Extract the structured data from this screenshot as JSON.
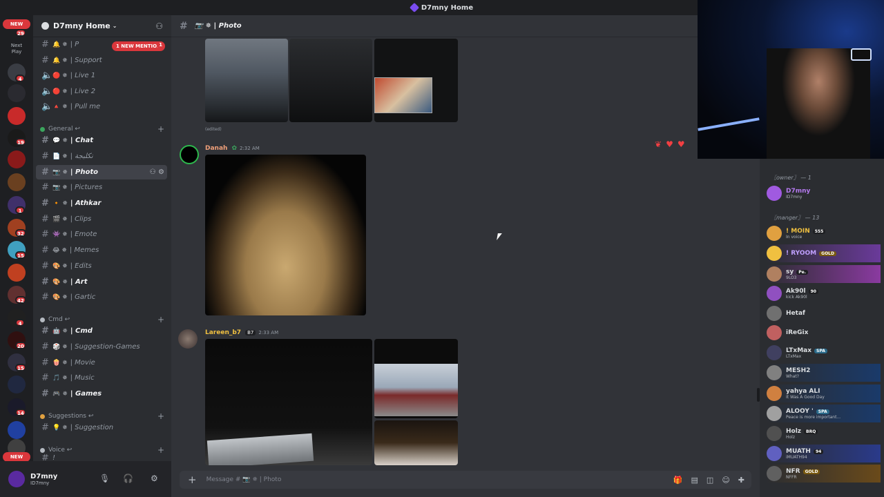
{
  "window": {
    "title": "D7mny Home"
  },
  "rail": {
    "new_top": "NEW",
    "badge_top": "29",
    "next_play": "Next Play",
    "badges": [
      "4",
      "19",
      "1",
      "32",
      "15",
      "42",
      "4",
      "20",
      "15",
      "14"
    ],
    "new_bottom": "NEW"
  },
  "server": {
    "name": "D7mny Home"
  },
  "mention": {
    "pill": "1 NEW MENTION",
    "count": "1"
  },
  "channels": {
    "top": [
      {
        "emoji": "🔔 ✵",
        "label": "| P"
      },
      {
        "emoji": "🔔 ✵",
        "label": "| Support"
      },
      {
        "emoji": "🔴 ✵",
        "label": "| Live 1"
      },
      {
        "emoji": "🔴 ✵",
        "label": "| Live 2"
      },
      {
        "emoji": "🔺 ✵",
        "label": "| Pull me"
      }
    ],
    "general_cat": "General ↩",
    "general": [
      {
        "emoji": "💬 ✵",
        "label": "| Chat"
      },
      {
        "emoji": "📄 ✵",
        "label": "| نكلبجة"
      },
      {
        "emoji": "📷 ✵",
        "label": "| Photo"
      },
      {
        "emoji": "📷 ✵",
        "label": "| Pictures"
      },
      {
        "emoji": "🔸 ✵",
        "label": "| Athkar"
      },
      {
        "emoji": "🎬 ✵",
        "label": "| Clips"
      },
      {
        "emoji": "👾 ✵",
        "label": "| Emote"
      },
      {
        "emoji": "😂 ✵",
        "label": "| Memes"
      },
      {
        "emoji": "🎨 ✵",
        "label": "| Edits"
      },
      {
        "emoji": "🎨 ✵",
        "label": "| Art"
      },
      {
        "emoji": "🎨 ✵",
        "label": "| Gartic"
      }
    ],
    "cmd_cat": "Cmd ↩",
    "cmd": [
      {
        "emoji": "🤖 ✵",
        "label": "| Cmd"
      },
      {
        "emoji": "🎲 ✵",
        "label": "| Suggestion-Games"
      },
      {
        "emoji": "🍿 ✵",
        "label": "| Movie"
      },
      {
        "emoji": "🎵 ✵",
        "label": "| Music"
      },
      {
        "emoji": "🎮 ✵",
        "label": "| Games"
      }
    ],
    "sugg_cat": "Suggestions ↩",
    "sugg": [
      {
        "emoji": "💡 ✵",
        "label": "| Suggestion"
      }
    ],
    "voice_cat": "Voice ↩",
    "voice_partial": "!"
  },
  "user": {
    "name": "D7mny",
    "tag": "ID7mny"
  },
  "chat": {
    "channel": "📷 ✵ | Photo",
    "edited": "(edited)",
    "msg1": {
      "author": "Danah",
      "time": "2:32 AM"
    },
    "msg2": {
      "author": "Lareen_b7",
      "badge": "B7",
      "time": "2:33 AM"
    },
    "input_placeholder": "Message # 📷 ✵ | Photo"
  },
  "members": {
    "role_owner": "〖owner〗 — 1",
    "role_manager": "〖manger〗 — 13",
    "list": [
      {
        "name": "D7mny",
        "status": "ID7mny",
        "tag": "",
        "color": "#a05ae0"
      },
      {
        "name": "! MOIN",
        "status": "In voice",
        "tag": "555",
        "color": "#e0a040"
      },
      {
        "name": "! RYOOM",
        "status": "",
        "tag": "GOLD",
        "color": "#f0c040"
      },
      {
        "name": "sy",
        "status": "9LO3",
        "tag": "Pe.",
        "color": "#b08060"
      },
      {
        "name": "Ak90l",
        "status": "kick Ak90l",
        "tag": "90",
        "color": "#9050c0"
      },
      {
        "name": "Hetaf",
        "status": "",
        "tag": "",
        "color": "#707070"
      },
      {
        "name": "iReGix",
        "status": "",
        "tag": "",
        "color": "#c06060"
      },
      {
        "name": "LTxMax",
        "status": "LTxMax",
        "tag": "SPA",
        "color": "#404060"
      },
      {
        "name": "MESH2",
        "status": "What?",
        "tag": "",
        "color": "#808080"
      },
      {
        "name": "yahya ALI",
        "status": "It Was A Good Day",
        "tag": "",
        "color": "#d08040"
      },
      {
        "name": "ALOOY '",
        "status": "Peace is more important...",
        "tag": "SPA",
        "color": "#a0a0a0"
      },
      {
        "name": "Holz",
        "status": "Holz",
        "tag": "BRQ",
        "color": "#505050"
      },
      {
        "name": "MUATH",
        "status": "iMUATH94",
        "tag": "94",
        "color": "#6060c0"
      },
      {
        "name": "NFR",
        "status": "NFFR",
        "tag": "GOLD",
        "color": "#606060"
      }
    ]
  }
}
